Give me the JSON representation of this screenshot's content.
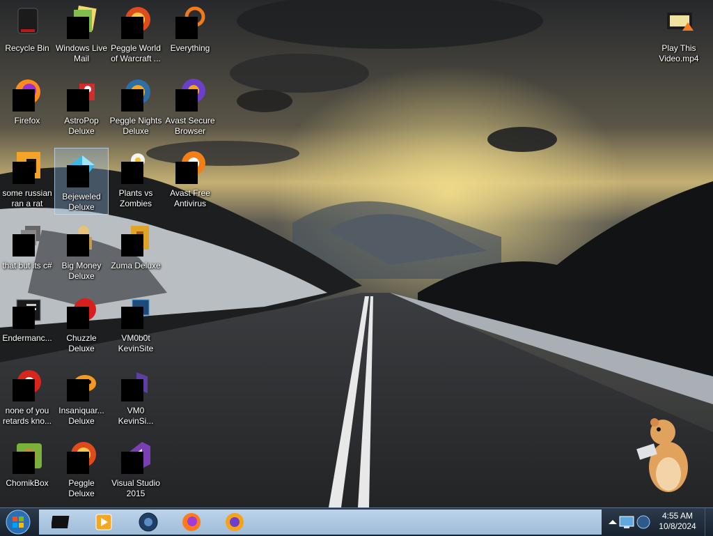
{
  "desktop": {
    "icons": [
      {
        "label": "Recycle Bin",
        "icon": "recycle-bin-icon"
      },
      {
        "label": "Windows Live Mail",
        "icon": "mail-icon"
      },
      {
        "label": "Peggle World of Warcraft ...",
        "icon": "peggle-icon"
      },
      {
        "label": "Everything",
        "icon": "search-icon"
      },
      {
        "label": "Firefox",
        "icon": "firefox-icon"
      },
      {
        "label": "AstroPop Deluxe",
        "icon": "astropop-icon"
      },
      {
        "label": "Peggle Nights Deluxe",
        "icon": "peggle-icon"
      },
      {
        "label": "Avast Secure Browser",
        "icon": "avast-browser-icon"
      },
      {
        "label": "some russian ran a rat",
        "icon": "document-icon"
      },
      {
        "label": "Bejeweled Deluxe",
        "icon": "gem-icon"
      },
      {
        "label": "Plants vs Zombies",
        "icon": "flower-icon"
      },
      {
        "label": "Avast Free Antivirus",
        "icon": "avast-icon"
      },
      {
        "label": "that but its c#",
        "icon": "folder-icon"
      },
      {
        "label": "Big Money Deluxe",
        "icon": "money-icon"
      },
      {
        "label": "Zuma Deluxe",
        "icon": "zuma-icon"
      },
      {
        "label": "Endermanc...",
        "icon": "app-icon"
      },
      {
        "label": "Chuzzle Deluxe",
        "icon": "chuzzle-icon"
      },
      {
        "label": "VM0b0t KevinSite",
        "icon": "vm-icon"
      },
      {
        "label": "none of you retards kno...",
        "icon": "chrome-icon"
      },
      {
        "label": "Insaniquar... Deluxe",
        "icon": "fish-icon"
      },
      {
        "label": "VM0 KevinSi...",
        "icon": "vm-icon"
      },
      {
        "label": "ChomikBox",
        "icon": "hamster-app-icon"
      },
      {
        "label": "Peggle Deluxe",
        "icon": "peggle-icon"
      },
      {
        "label": "Visual Studio 2015",
        "icon": "visual-studio-icon"
      },
      {
        "label": "Play This Video.mp4",
        "icon": "video-file-icon"
      }
    ]
  },
  "taskbar": {
    "pinned": [
      {
        "icon": "terminal-icon"
      },
      {
        "icon": "media-player-icon"
      },
      {
        "icon": "app-icon"
      },
      {
        "icon": "firefox-icon"
      },
      {
        "icon": "avast-browser-icon"
      }
    ],
    "tray_icons": [
      "show-hidden-icons-icon",
      "network-icon",
      "app-icon"
    ]
  },
  "clock": {
    "time": "4:55 AM",
    "date": "10/8/2024"
  },
  "colors": {
    "taskbar": "#1f2a38",
    "task_strip": "#b0c8e2",
    "selection": "#96bee6"
  }
}
